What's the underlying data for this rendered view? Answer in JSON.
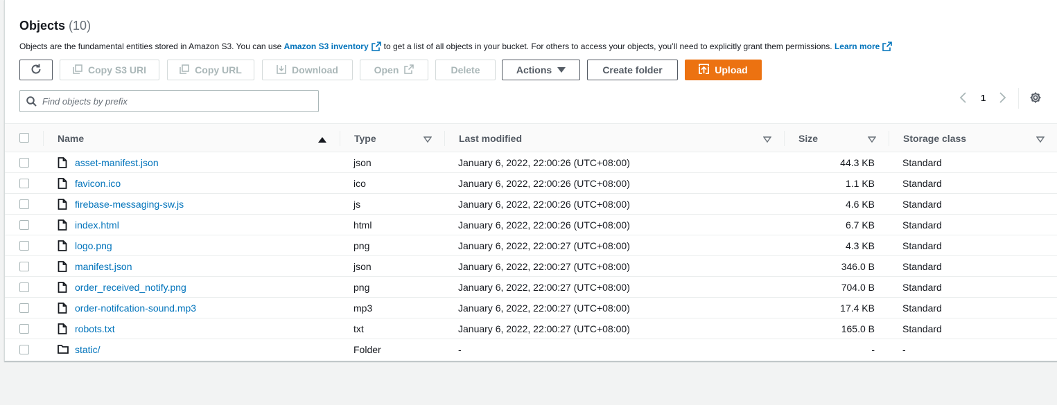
{
  "header": {
    "title": "Objects",
    "count": "(10)",
    "desc_prefix": "Objects are the fundamental entities stored in Amazon S3. You can use",
    "inventory_link": "Amazon S3 inventory",
    "desc_middle": "to get a list of all objects in your bucket. For others to access your objects, you’ll need to explicitly grant them permissions.",
    "learn_more": "Learn more"
  },
  "toolbar": {
    "copy_s3_uri": "Copy S3 URI",
    "copy_url": "Copy URL",
    "download": "Download",
    "open": "Open",
    "delete": "Delete",
    "actions": "Actions",
    "create_folder": "Create folder",
    "upload": "Upload"
  },
  "search": {
    "placeholder": "Find objects by prefix"
  },
  "pagination": {
    "current_page": "1"
  },
  "table": {
    "columns": [
      "Name",
      "Type",
      "Last modified",
      "Size",
      "Storage class"
    ],
    "rows": [
      {
        "name": "asset-manifest.json",
        "type": "json",
        "modified": "January 6, 2022, 22:00:26 (UTC+08:00)",
        "size": "44.3 KB",
        "storage": "Standard",
        "kind": "file"
      },
      {
        "name": "favicon.ico",
        "type": "ico",
        "modified": "January 6, 2022, 22:00:26 (UTC+08:00)",
        "size": "1.1 KB",
        "storage": "Standard",
        "kind": "file"
      },
      {
        "name": "firebase-messaging-sw.js",
        "type": "js",
        "modified": "January 6, 2022, 22:00:26 (UTC+08:00)",
        "size": "4.6 KB",
        "storage": "Standard",
        "kind": "file"
      },
      {
        "name": "index.html",
        "type": "html",
        "modified": "January 6, 2022, 22:00:26 (UTC+08:00)",
        "size": "6.7 KB",
        "storage": "Standard",
        "kind": "file"
      },
      {
        "name": "logo.png",
        "type": "png",
        "modified": "January 6, 2022, 22:00:27 (UTC+08:00)",
        "size": "4.3 KB",
        "storage": "Standard",
        "kind": "file"
      },
      {
        "name": "manifest.json",
        "type": "json",
        "modified": "January 6, 2022, 22:00:27 (UTC+08:00)",
        "size": "346.0 B",
        "storage": "Standard",
        "kind": "file"
      },
      {
        "name": "order_received_notify.png",
        "type": "png",
        "modified": "January 6, 2022, 22:00:27 (UTC+08:00)",
        "size": "704.0 B",
        "storage": "Standard",
        "kind": "file"
      },
      {
        "name": "order-notifcation-sound.mp3",
        "type": "mp3",
        "modified": "January 6, 2022, 22:00:27 (UTC+08:00)",
        "size": "17.4 KB",
        "storage": "Standard",
        "kind": "file"
      },
      {
        "name": "robots.txt",
        "type": "txt",
        "modified": "January 6, 2022, 22:00:27 (UTC+08:00)",
        "size": "165.0 B",
        "storage": "Standard",
        "kind": "file"
      },
      {
        "name": "static/",
        "type": "Folder",
        "modified": "-",
        "size": "-",
        "storage": "-",
        "kind": "folder"
      }
    ]
  },
  "colors": {
    "link": "#0073bb",
    "primary": "#ec7211",
    "border": "#545b64",
    "disabled": "#aab7b8"
  }
}
